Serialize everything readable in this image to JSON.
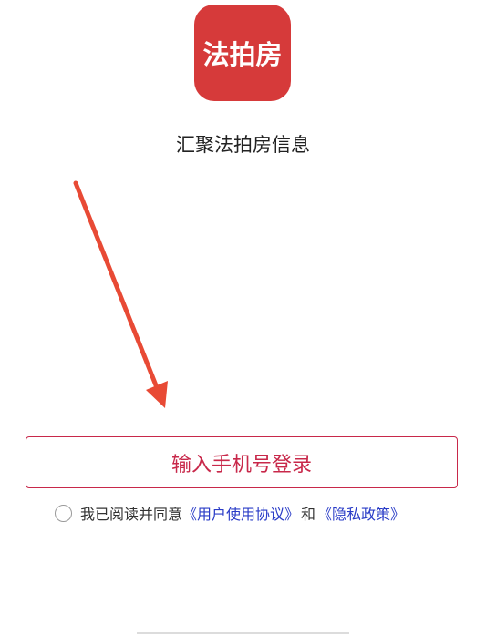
{
  "app": {
    "logo_text": "法拍房",
    "tagline": "汇聚法拍房信息",
    "brand_color": "#d63a3a"
  },
  "login": {
    "button_label": "输入手机号登录",
    "accent_color": "#c8284a"
  },
  "agreement": {
    "checked": false,
    "prefix": "我已阅读并同意",
    "user_agreement_link": "《用户使用协议》",
    "and": "和",
    "privacy_policy_link": "《隐私政策》",
    "link_color": "#2a3cc7"
  },
  "annotation": {
    "arrow_color": "#e84a35"
  }
}
